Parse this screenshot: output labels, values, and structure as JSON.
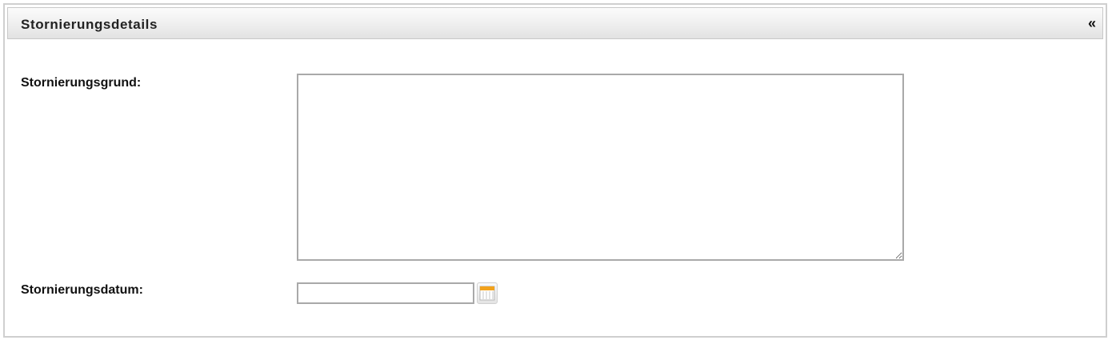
{
  "panel": {
    "title": "Stornierungsdetails",
    "collapse_label": "«"
  },
  "form": {
    "reason": {
      "label": "Stornierungsgrund:",
      "value": ""
    },
    "date": {
      "label": "Stornierungsdatum:",
      "value": "",
      "button_icon": "calendar-icon"
    }
  },
  "colors": {
    "calendar_accent": "#f2a21c",
    "border": "#a9a9a9"
  }
}
